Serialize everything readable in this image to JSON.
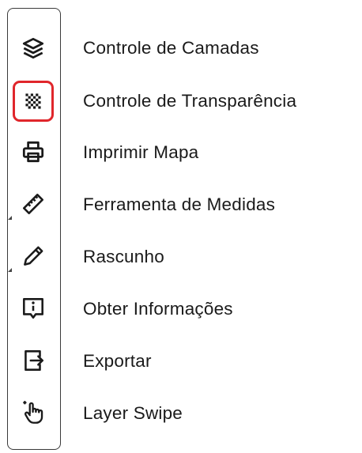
{
  "tools": [
    {
      "icon": "layers-icon",
      "label": "Controle de Camadas"
    },
    {
      "icon": "transparency-checker-icon",
      "label": "Controle de Transparência",
      "selected": true
    },
    {
      "icon": "printer-icon",
      "label": "Imprimir Mapa"
    },
    {
      "icon": "ruler-icon",
      "label": "Ferramenta de Medidas"
    },
    {
      "icon": "pencil-icon",
      "label": "Rascunho"
    },
    {
      "icon": "info-icon",
      "label": "Obter Informações"
    },
    {
      "icon": "export-icon",
      "label": "Exportar"
    },
    {
      "icon": "hand-pointer-icon",
      "label": "Layer Swipe"
    }
  ],
  "colors": {
    "selected_border": "#e0262b",
    "icon": "#1a1a1a",
    "text": "#1a1a1a"
  }
}
